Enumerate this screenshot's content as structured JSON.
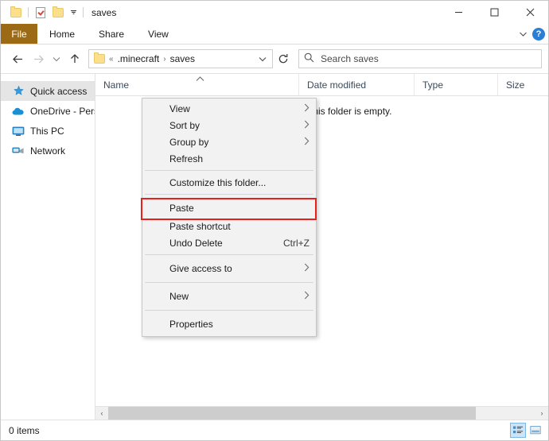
{
  "window": {
    "title": "saves",
    "quick_access_toolbar": [
      {
        "name": "folder-properties-icon",
        "label": "Properties"
      },
      {
        "name": "checklist-icon",
        "label": "Properties"
      },
      {
        "name": "new-folder-icon",
        "label": "New folder"
      },
      {
        "name": "customize-qat-caret",
        "label": "Customize Quick Access Toolbar"
      }
    ],
    "controls": {
      "minimize": "–",
      "maximize": "□",
      "close": "✕"
    }
  },
  "ribbon": {
    "file_tab": "File",
    "tabs": [
      "Home",
      "Share",
      "View"
    ],
    "collapse_caret": "⌄",
    "help_label": "?",
    "file_tab_color": "#9c6a14"
  },
  "navigation": {
    "back": "←",
    "forward": "→",
    "recent": "⌄",
    "up": "↑",
    "refresh": "↻",
    "address_caret": "⌄",
    "breadcrumb_prefix": "«",
    "breadcrumbs": [
      ".minecraft",
      "saves"
    ],
    "breadcrumb_separator": "›"
  },
  "search": {
    "placeholder": "Search saves",
    "icon": "search-icon"
  },
  "sidebar": {
    "items": [
      {
        "label": "Quick access",
        "icon": "pin-star-icon",
        "selected": true
      },
      {
        "label": "OneDrive - Pers",
        "icon": "cloud-icon",
        "selected": false
      },
      {
        "label": "This PC",
        "icon": "monitor-icon",
        "selected": false
      },
      {
        "label": "Network",
        "icon": "network-icon",
        "selected": false
      }
    ]
  },
  "file_list": {
    "columns": [
      {
        "label": "Name",
        "sorted": true,
        "sort_marker": "ⱏ"
      },
      {
        "label": "Date modified",
        "sorted": false
      },
      {
        "label": "Type",
        "sorted": false
      },
      {
        "label": "Size",
        "sorted": false
      }
    ],
    "empty_message": "This folder is empty.",
    "rows": []
  },
  "context_menu": {
    "items": [
      {
        "label": "View",
        "submenu": true,
        "accel": "",
        "separator_after": false
      },
      {
        "label": "Sort by",
        "submenu": true,
        "accel": "",
        "separator_after": false
      },
      {
        "label": "Group by",
        "submenu": true,
        "accel": "",
        "separator_after": false
      },
      {
        "label": "Refresh",
        "submenu": false,
        "accel": "",
        "separator_after": true
      },
      {
        "label": "Customize this folder...",
        "submenu": false,
        "accel": "",
        "separator_after": true
      },
      {
        "label": "Paste",
        "submenu": false,
        "accel": "",
        "separator_after": false,
        "highlighted": true
      },
      {
        "label": "Paste shortcut",
        "submenu": false,
        "accel": "",
        "separator_after": false
      },
      {
        "label": "Undo Delete",
        "submenu": false,
        "accel": "Ctrl+Z",
        "separator_after": true
      },
      {
        "label": "Give access to",
        "submenu": true,
        "accel": "",
        "separator_after": true
      },
      {
        "label": "New",
        "submenu": true,
        "accel": "",
        "separator_after": true
      },
      {
        "label": "Properties",
        "submenu": false,
        "accel": "",
        "separator_after": false
      }
    ],
    "submenu_arrow": "›",
    "highlight_color": "#e8201a"
  },
  "status_bar": {
    "item_count": "0 items",
    "view_buttons": [
      {
        "name": "details-view-button",
        "active": true
      },
      {
        "name": "large-icons-view-button",
        "active": false
      }
    ]
  },
  "scrollbar": {
    "left_arrow": "‹",
    "right_arrow": "›"
  }
}
